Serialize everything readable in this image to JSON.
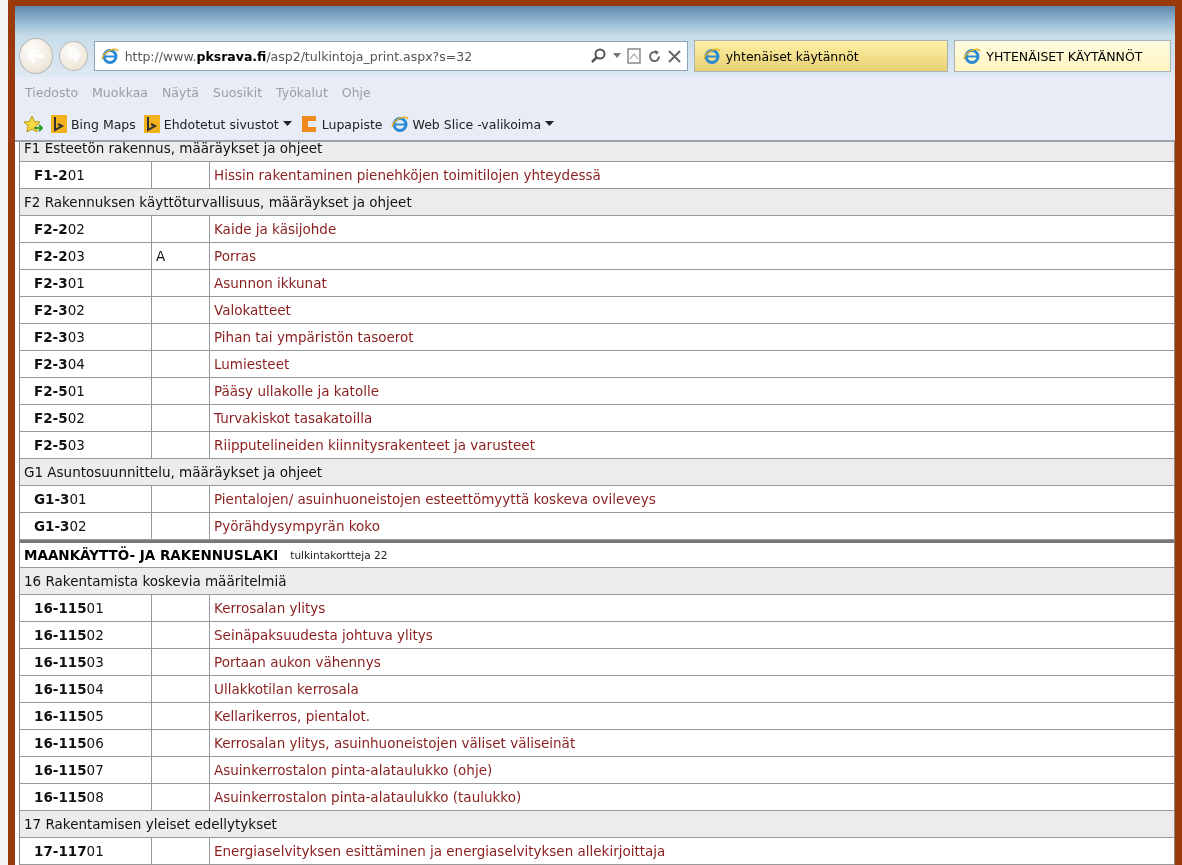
{
  "browser": {
    "address": "http://www.**pksrava.fi**/asp2/tulkintoja_print.aspx?s=32",
    "tabs": [
      {
        "label": "yhtenäiset käytännöt",
        "selected": true
      },
      {
        "label": "YHTENÄISET KÄYTÄNNÖT",
        "selected": false
      }
    ],
    "menu": [
      "Tiedosto",
      "Muokkaa",
      "Näytä",
      "Suosikit",
      "Työkalut",
      "Ohje"
    ],
    "favorites": [
      {
        "label": "Bing Maps",
        "kind": "bing",
        "dropdown": false
      },
      {
        "label": "Ehdotetut sivustot",
        "kind": "bing",
        "dropdown": true
      },
      {
        "label": "Lupapiste",
        "kind": "lupapiste",
        "dropdown": false
      },
      {
        "label": "Web Slice -valikoima",
        "kind": "page",
        "dropdown": true
      }
    ]
  },
  "rows": [
    {
      "kind": "group",
      "title": "F1 Esteetön rakennus, määräykset ja ohjeet"
    },
    {
      "kind": "item",
      "code": "**F1-2**01",
      "mark": "",
      "title": "Hissin rakentaminen pienehköjen toimitilojen yhteydessä"
    },
    {
      "kind": "group",
      "title": "F2 Rakennuksen käyttöturvallisuus, määräykset ja ohjeet"
    },
    {
      "kind": "item",
      "code": "**F2-2**02",
      "mark": "",
      "title": "Kaide ja käsijohde"
    },
    {
      "kind": "item",
      "code": "**F2-2**03",
      "mark": "A",
      "title": "Porras"
    },
    {
      "kind": "item",
      "code": "**F2-3**01",
      "mark": "",
      "title": "Asunnon ikkunat"
    },
    {
      "kind": "item",
      "code": "**F2-3**02",
      "mark": "",
      "title": "Valokatteet"
    },
    {
      "kind": "item",
      "code": "**F2-3**03",
      "mark": "",
      "title": "Pihan tai ympäristön tasoerot"
    },
    {
      "kind": "item",
      "code": "**F2-3**04",
      "mark": "",
      "title": "Lumiesteet"
    },
    {
      "kind": "item",
      "code": "**F2-5**01",
      "mark": "",
      "title": "Pääsy ullakolle ja katolle"
    },
    {
      "kind": "item",
      "code": "**F2-5**02",
      "mark": "",
      "title": "Turvakiskot tasakatoilla"
    },
    {
      "kind": "item",
      "code": "**F2-5**03",
      "mark": "",
      "title": "Riipputelineiden kiinnitysrakenteet ja varusteet"
    },
    {
      "kind": "group",
      "title": "G1 Asuntosuunnittelu, määräykset ja ohjeet"
    },
    {
      "kind": "item",
      "code": "**G1-3**01",
      "mark": "",
      "title": "Pientalojen/ asuinhuoneistojen esteettömyyttä koskeva ovileveys"
    },
    {
      "kind": "item",
      "code": "**G1-3**02",
      "mark": "",
      "title": "Pyörähdysympyrän koko"
    },
    {
      "kind": "law",
      "title": "MAANKÄYTTÖ- JA RAKENNUSLAKI",
      "note": "tulkintakortteja 22"
    },
    {
      "kind": "group",
      "title": "16 Rakentamista koskevia määritelmiä"
    },
    {
      "kind": "item",
      "code": "**16-115**01",
      "mark": "",
      "title": "Kerrosalan ylitys"
    },
    {
      "kind": "item",
      "code": "**16-115**02",
      "mark": "",
      "title": "Seinäpaksuudesta johtuva ylitys"
    },
    {
      "kind": "item",
      "code": "**16-115**03",
      "mark": "",
      "title": "Portaan aukon vähennys"
    },
    {
      "kind": "item",
      "code": "**16-115**04",
      "mark": "",
      "title": "Ullakkotilan kerrosala"
    },
    {
      "kind": "item",
      "code": "**16-115**05",
      "mark": "",
      "title": "Kellarikerros, pientalot."
    },
    {
      "kind": "item",
      "code": "**16-115**06",
      "mark": "",
      "title": "Kerrosalan ylitys, asuinhuoneistojen väliset väliseinät"
    },
    {
      "kind": "item",
      "code": "**16-115**07",
      "mark": "",
      "title": "Asuinkerrostalon pinta-alataulukko (ohje)"
    },
    {
      "kind": "item",
      "code": "**16-115**08",
      "mark": "",
      "title": "Asuinkerrostalon pinta-alataulukko (taulukko)"
    },
    {
      "kind": "group",
      "title": "17 Rakentamisen yleiset edellytykset"
    },
    {
      "kind": "item",
      "code": "**17-117**01",
      "mark": "",
      "title": "Energiaselvityksen esittäminen ja energiaselvityksen allekirjoittaja"
    }
  ]
}
